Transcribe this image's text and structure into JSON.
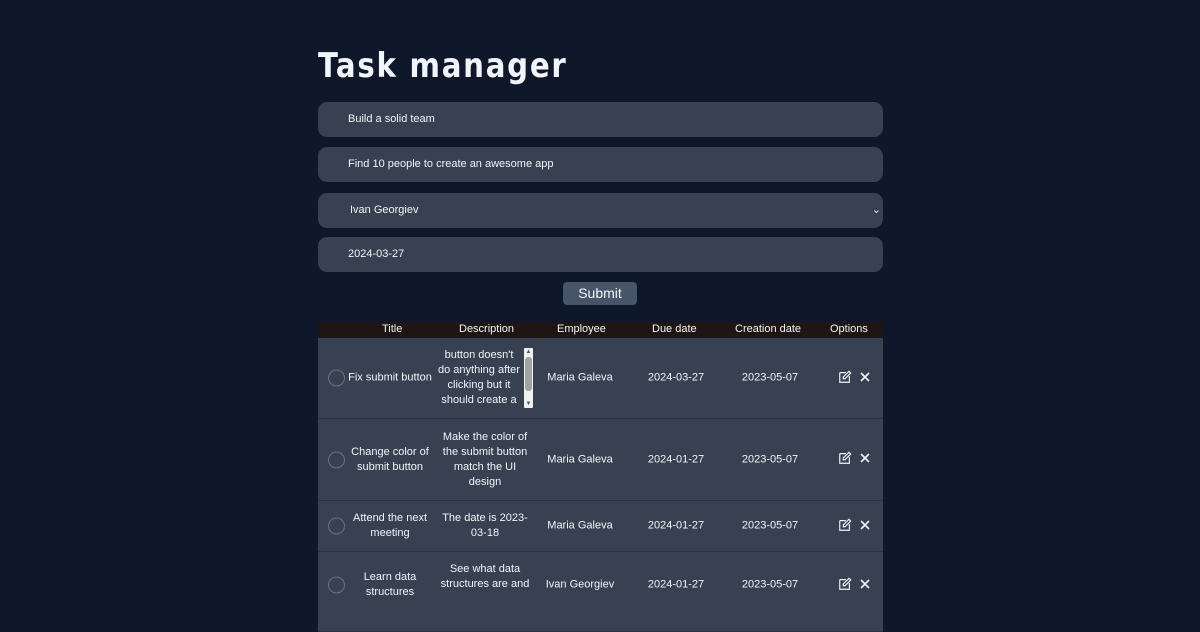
{
  "app": {
    "title": "Task manager"
  },
  "form": {
    "title_value": "Build a solid team",
    "description_value": "Find 10 people to create an awesome app",
    "employee_selected": "Ivan Georgiev",
    "due_date_value": "2024-03-27",
    "submit_label": "Submit"
  },
  "table": {
    "headers": [
      "Title",
      "Description",
      "Employee",
      "Due date",
      "Creation date",
      "Options"
    ],
    "rows": [
      {
        "title": [
          "Fix submit button"
        ],
        "description": [
          "button doesn't",
          "do anything after",
          "clicking but it",
          "should create a"
        ],
        "employee": "Maria Galeva",
        "due_date": "2024-03-27",
        "creation_date": "2023-05-07"
      },
      {
        "title": [
          "Change color of",
          "submit button"
        ],
        "description": [
          "Make the color of",
          "the submit button",
          "match the UI",
          "design"
        ],
        "employee": "Maria Galeva",
        "due_date": "2024-01-27",
        "creation_date": "2023-05-07"
      },
      {
        "title": [
          "Attend the next",
          "meeting"
        ],
        "description": [
          "The date is 2023-",
          "03-18"
        ],
        "employee": "Maria Galeva",
        "due_date": "2024-01-27",
        "creation_date": "2023-05-07"
      },
      {
        "title": [
          "Learn data",
          "structures"
        ],
        "description": [
          "See what data",
          "structures are and"
        ],
        "employee": "Ivan Georgiev",
        "due_date": "2024-01-27",
        "creation_date": "2023-05-07"
      }
    ]
  },
  "icons": {
    "edit": "edit-icon",
    "delete": "close-icon",
    "complete": "circle-checkbox-icon"
  },
  "colors": {
    "background": "#0f172a",
    "field": "#374151",
    "header": "#1f1614",
    "button": "#475569"
  }
}
